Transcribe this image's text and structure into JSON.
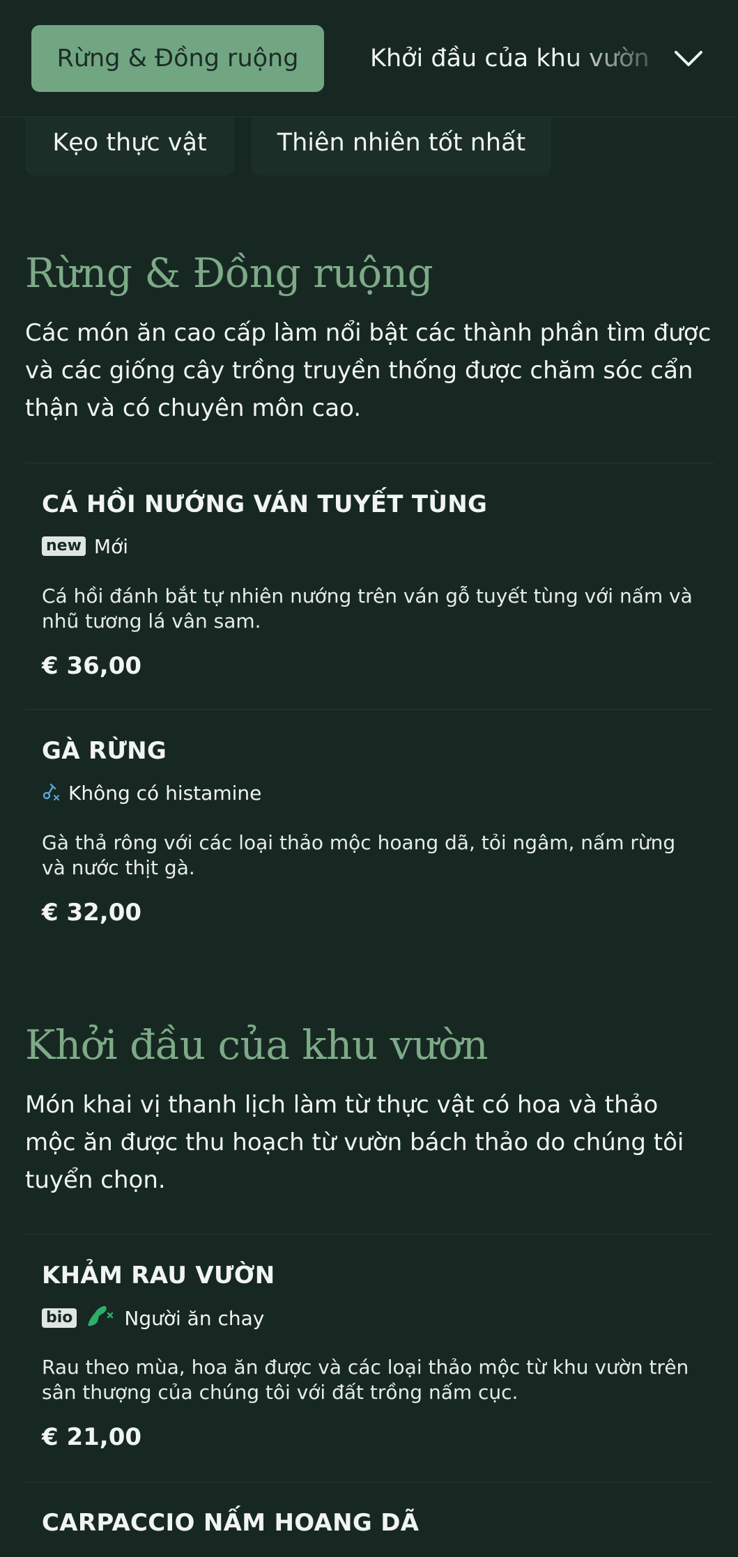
{
  "header": {
    "active_category": "Rừng & Đồng ruộng",
    "next_category": "Khởi đầu của khu vườn"
  },
  "chips": [
    {
      "label": "Kẹo thực vật"
    },
    {
      "label": "Thiên nhiên tốt nhất"
    }
  ],
  "sections": [
    {
      "title": "Rừng & Đồng ruộng",
      "description": "Các món ăn cao cấp làm nổi bật các thành phần tìm được và các giống cây trồng truyền thống được chăm sóc cẩn thận và có chuyên môn cao.",
      "items": [
        {
          "name": "CÁ HỒI NƯỚNG VÁN TUYẾT TÙNG",
          "badge": "new",
          "tag": "Mới",
          "description": "Cá hồi đánh bắt tự nhiên nướng trên ván gỗ tuyết tùng với nấm và nhũ tương lá vân sam.",
          "price": "€ 36,00"
        },
        {
          "name": "GÀ RỪNG",
          "icon": "histamine-free-icon",
          "tag": "Không có histamine",
          "description": "Gà thả rông với các loại thảo mộc hoang dã, tỏi ngâm, nấm rừng và nước thịt gà.",
          "price": "€ 32,00"
        }
      ]
    },
    {
      "title": "Khởi đầu của khu vườn",
      "description": "Món khai vị thanh lịch làm từ thực vật có hoa và thảo mộc ăn được thu hoạch từ vườn bách thảo do chúng tôi tuyển chọn.",
      "items": [
        {
          "name": "KHẢM RAU VƯỜN",
          "badge": "bio",
          "icon": "vegetarian-icon",
          "tag": "Người ăn chay",
          "description": "Rau theo mùa, hoa ăn được và các loại thảo mộc từ khu vườn trên sân thượng của chúng tôi với đất trồng nấm cục.",
          "price": "€ 21,00"
        },
        {
          "name": "CARPACCIO NẤM HOANG DÃ"
        }
      ]
    }
  ],
  "colors": {
    "background": "#172823",
    "accent": "#72a682",
    "section_title": "#7eaa87",
    "histamine_icon": "#5aa6d6",
    "vegetarian_icon": "#2fae6a"
  }
}
